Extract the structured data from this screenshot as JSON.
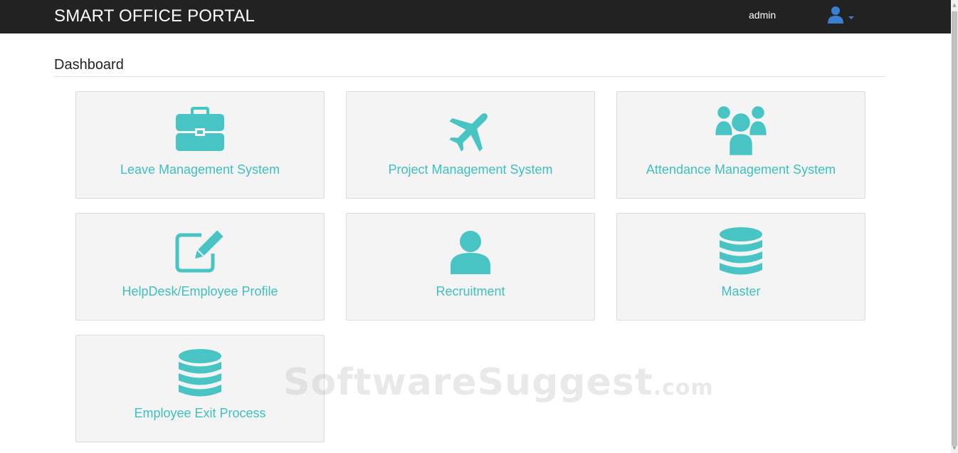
{
  "header": {
    "brand": "SMART OFFICE PORTAL",
    "username": "admin",
    "user_icon": "user-icon",
    "dropdown_icon": "caret-down-icon",
    "accent_color": "#3a7fd0"
  },
  "page": {
    "title": "Dashboard"
  },
  "tiles": [
    {
      "label": "Leave Management System",
      "icon": "briefcase-icon"
    },
    {
      "label": "Project Management System",
      "icon": "plane-icon"
    },
    {
      "label": "Attendance Management System",
      "icon": "users-icon"
    },
    {
      "label": "HelpDesk/Employee Profile",
      "icon": "edit-icon"
    },
    {
      "label": "Recruitment",
      "icon": "user-icon"
    },
    {
      "label": "Master",
      "icon": "database-icon"
    },
    {
      "label": "Employee Exit Process",
      "icon": "database-icon"
    }
  ],
  "theme": {
    "navbar_bg": "#222222",
    "tile_bg": "#f4f4f4",
    "tile_text": "#3fbfbf",
    "icon_color": "#48c4c4"
  },
  "watermark": {
    "main": "SoftwareSuggest",
    "suffix": ".com"
  }
}
